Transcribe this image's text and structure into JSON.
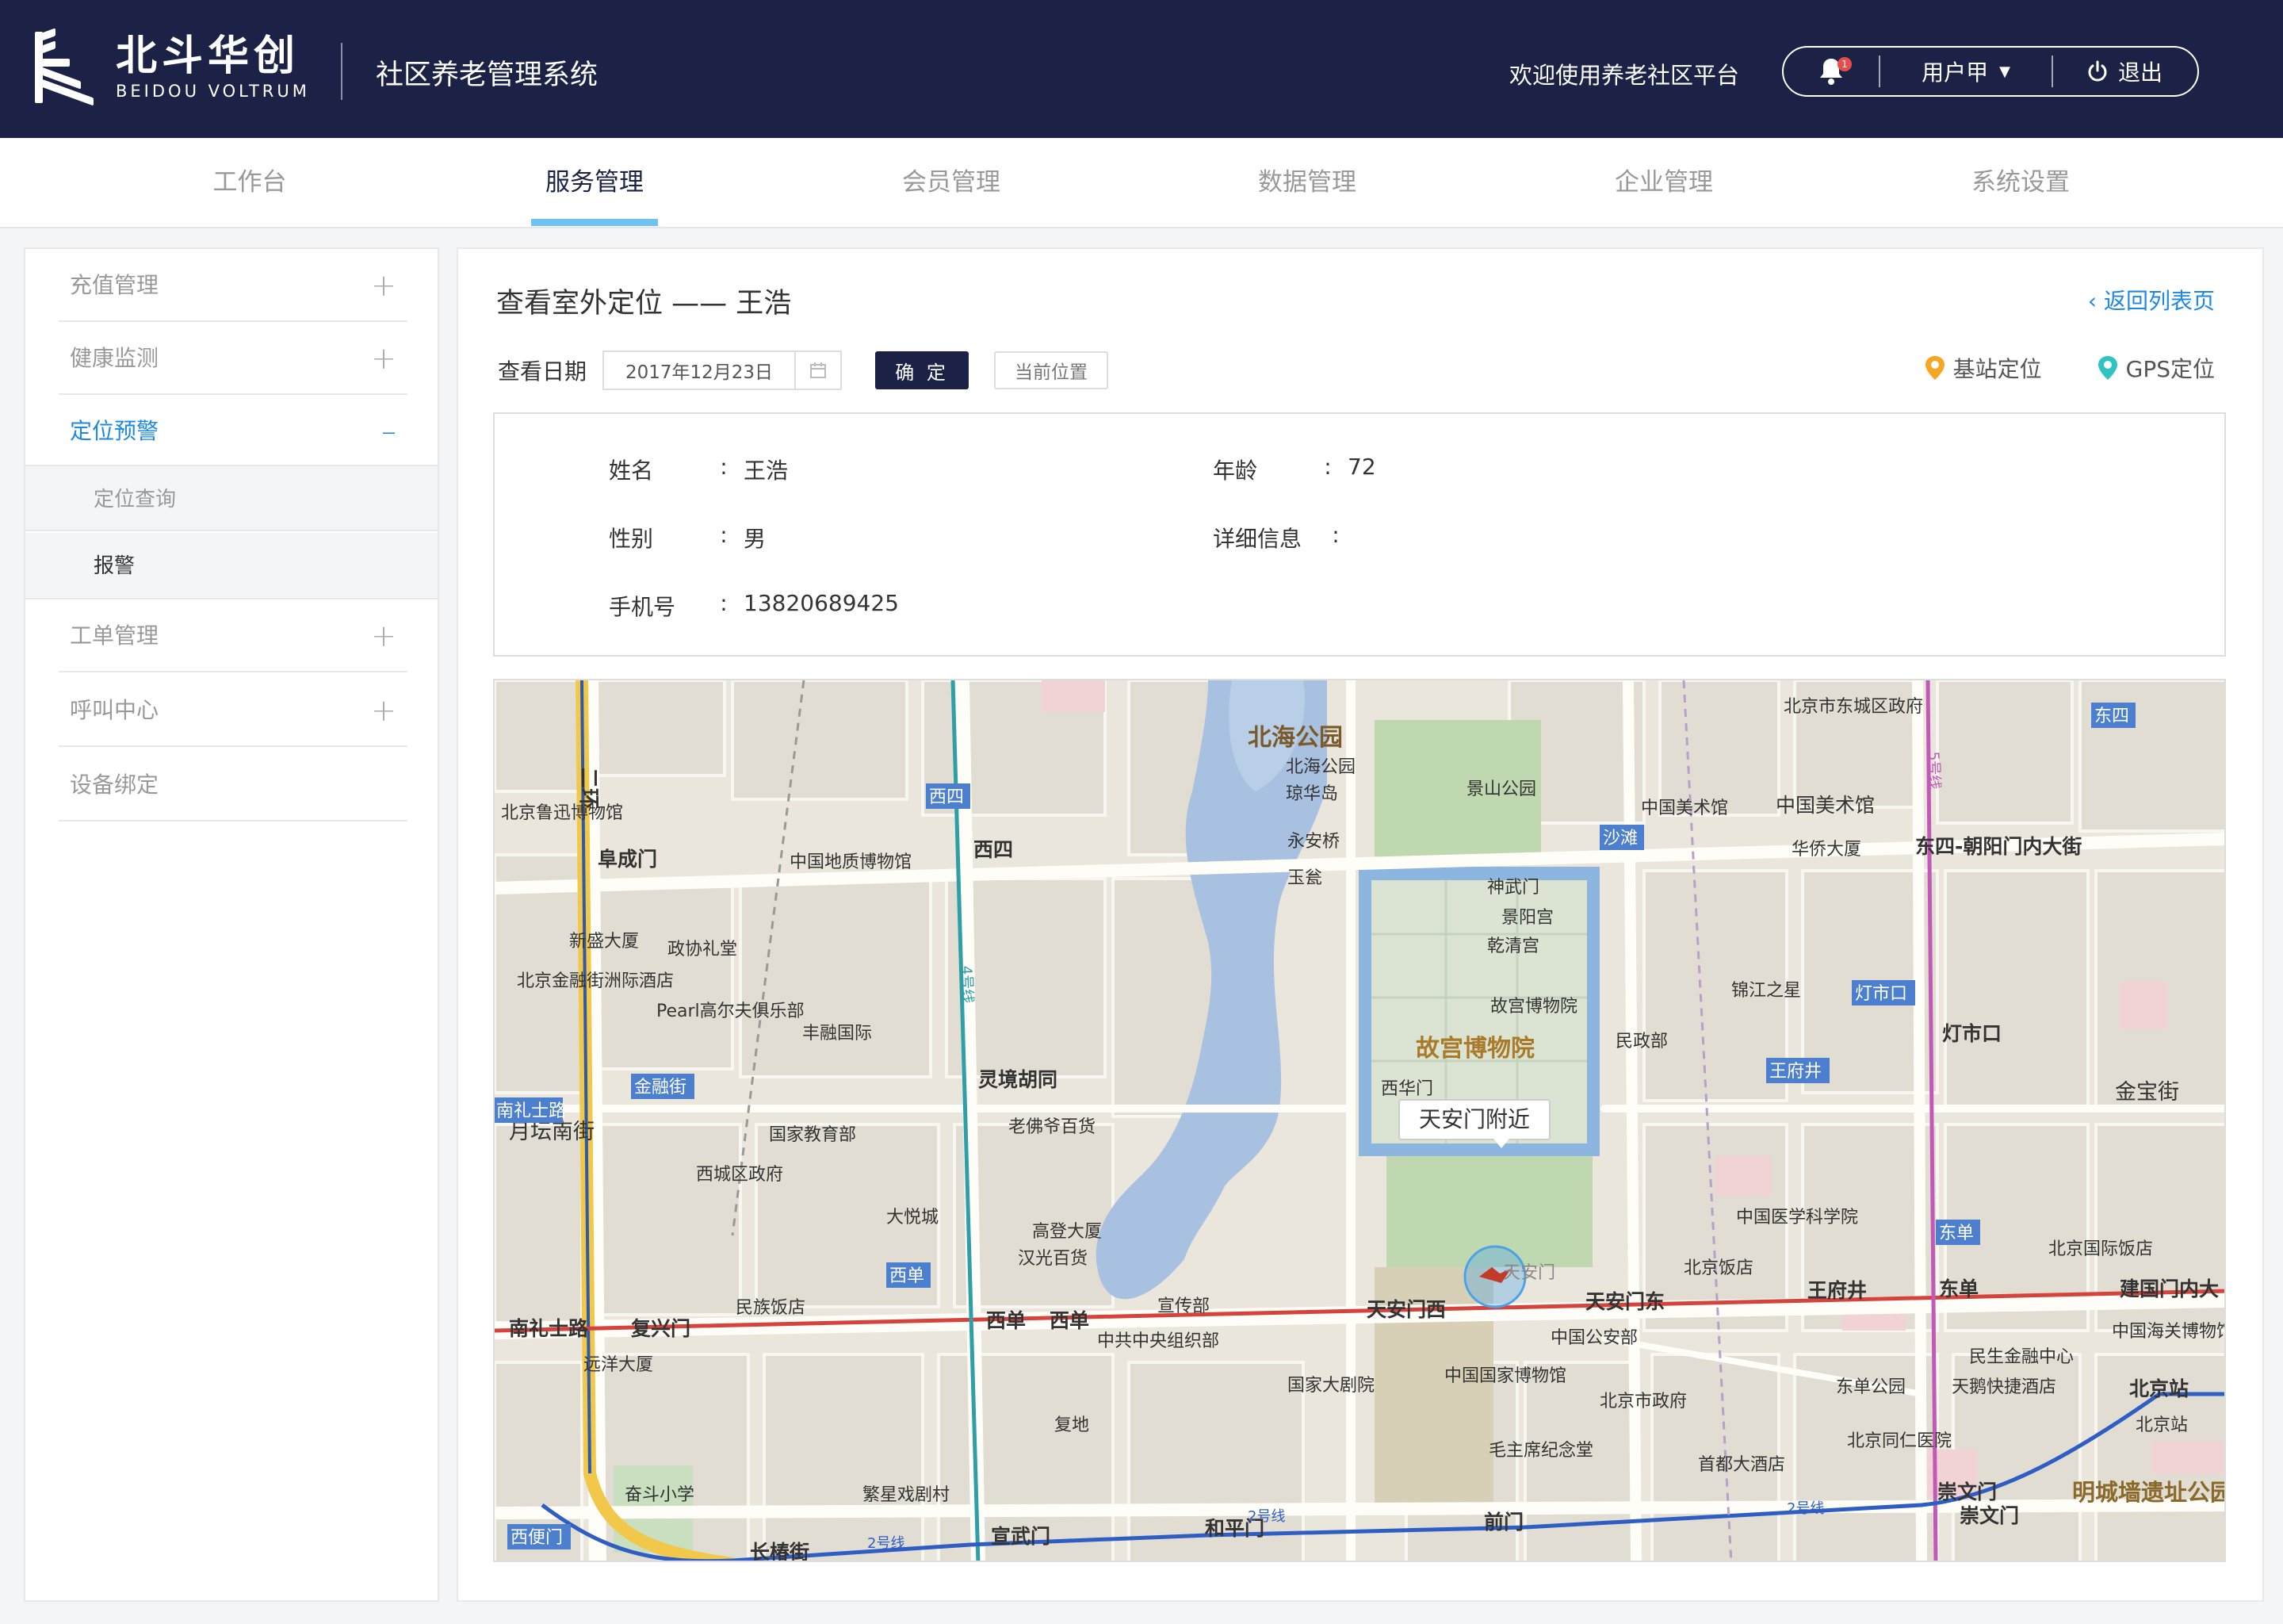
{
  "header": {
    "logo_cn": "北斗华创",
    "logo_en": "BEIDOU VOLTRUM",
    "system_title": "社区养老管理系统",
    "welcome": "欢迎使用养老社区平台",
    "notification_count": "1",
    "user_name": "用户甲",
    "logout": "退出"
  },
  "nav": {
    "tabs": [
      {
        "label": "工作台"
      },
      {
        "label": "服务管理"
      },
      {
        "label": "会员管理"
      },
      {
        "label": "数据管理"
      },
      {
        "label": "企业管理"
      },
      {
        "label": "系统设置"
      }
    ],
    "active_index": 1
  },
  "sidebar": {
    "items": [
      {
        "label": "充值管理"
      },
      {
        "label": "健康监测"
      },
      {
        "label": "定位预警"
      },
      {
        "label": "工单管理"
      },
      {
        "label": "呼叫中心"
      },
      {
        "label": "设备绑定"
      }
    ],
    "subitems": [
      {
        "label": "定位查询"
      },
      {
        "label": "报警"
      }
    ]
  },
  "main": {
    "title": "查看室外定位 —— 王浩",
    "back_link": "返回列表页",
    "date_label": "查看日期",
    "date_value": "2017年12月23日",
    "confirm_button": "确 定",
    "current_position_button": "当前位置",
    "legend_base_station": "基站定位",
    "legend_gps": "GPS定位",
    "info": {
      "name_label": "姓名",
      "name_value": "王浩",
      "age_label": "年龄",
      "age_value": "72",
      "gender_label": "性别",
      "gender_value": "男",
      "detail_label": "详细信息",
      "detail_value": "",
      "phone_label": "手机号",
      "phone_value": "13820689425",
      "colon": ":"
    }
  },
  "map": {
    "callout": "天安门附近",
    "labels": {
      "beihai": "北海公园",
      "gugong": "故宫博物院",
      "jingshan": "景山公园",
      "shenwumen": "神武门",
      "jingyang": "景阳宫",
      "qianqing": "乾清宫",
      "gugong_poi": "故宫博物院",
      "xihuamen": "西华门",
      "tiananmen": "天安门",
      "tiananmen_xi": "天安门西",
      "tiananmen_dong": "天安门东",
      "wangfujing": "王府井",
      "wangfujing_tag": "王府井",
      "dongdan": "东单",
      "dongdan_tag": "东单",
      "xidan": "西单",
      "xidan_tag": "西单",
      "xidan_metro": "西单",
      "xisi": "西四",
      "xisi_tag": "西四",
      "fuchengmen": "阜成门",
      "lingjing": "灵境胡同",
      "dongsi_tag": "东四",
      "dongsi": "东四-朝阳门内大街",
      "dengshikou": "灯市口",
      "dengshikou_tag": "灯市口",
      "jinbao": "金宝街",
      "shatan": "沙滩",
      "minzu": "民族饭店",
      "fuxingmen": "复兴门",
      "nanlishilu": "南礼士路",
      "nanlishilu_tag": "南礼士路",
      "yuetan": "月坛南街",
      "jinrongjie": "金融街",
      "changchun": "长椿街",
      "xuanwumen": "宣武门",
      "hepingmen": "和平门",
      "qianmen": "前门",
      "chongwenmen": "崇文门",
      "chongwenmen2": "崇文门",
      "beijingzhan": "北京站",
      "beijingzhan2": "北京站",
      "mingcheng": "明城墙遗址公园",
      "jianguomennei": "建国门内大",
      "guojiadajuyuan": "国家大剧院",
      "guobo": "中国国家博物馆",
      "maozhuxi": "毛主席纪念堂",
      "gonganbu": "中国公安部",
      "xuanchuan": "宣传部",
      "zhongzu": "中共中央组织部",
      "beijingfandian": "北京饭店",
      "yixueyuan": "中国医学科学院",
      "beijingshi": "北京市政府",
      "shoudu": "首都大酒店",
      "tongren": "北京同仁医院",
      "dongdan_park": "东单公园",
      "minsheng": "民生金融中心",
      "haiguan": "中国海关博物馆",
      "guoji_fandian": "北京国际饭店",
      "tianba": "天鹅快捷酒店",
      "meishuguan": "中国美术馆",
      "meishuguan2": "中国美术馆",
      "huaqiao": "华侨大厦",
      "jinjiang": "锦江之星",
      "minzhengbu": "民政部",
      "dongcheng": "北京市东城区政府",
      "luxun": "北京鲁迅博物馆",
      "dizhi": "中国地质博物馆",
      "zhengxie": "政协礼堂",
      "xinsheng": "新盛大厦",
      "zhouji": "北京金融街洲际酒店",
      "pearl": "Pearl高尔夫俱乐部",
      "fengrong": "丰融国际",
      "jiaoyubu": "国家教育部",
      "xicheng": "西城区政府",
      "dayuecheng": "大悦城",
      "gaodeng": "高登大厦",
      "hanguang": "汉光百货",
      "laofoye": "老佛爷百货",
      "fudi": "复地",
      "fanxing": "繁星戏剧村",
      "fendou": "奋斗小学",
      "yuanyang": "远洋大厦",
      "beihai_poi": "北海公园",
      "qionghua": "琼华岛",
      "yongan": "永安桥",
      "yuyu": "玉瓮",
      "xibianmen": "西便门",
      "jinianguan": "首都大酒店",
      "line2_a": "2号线",
      "line2_b": "2号线",
      "line2_c": "2号线",
      "line4": "4号线",
      "line5": "5号线",
      "ring2": "二环"
    }
  }
}
